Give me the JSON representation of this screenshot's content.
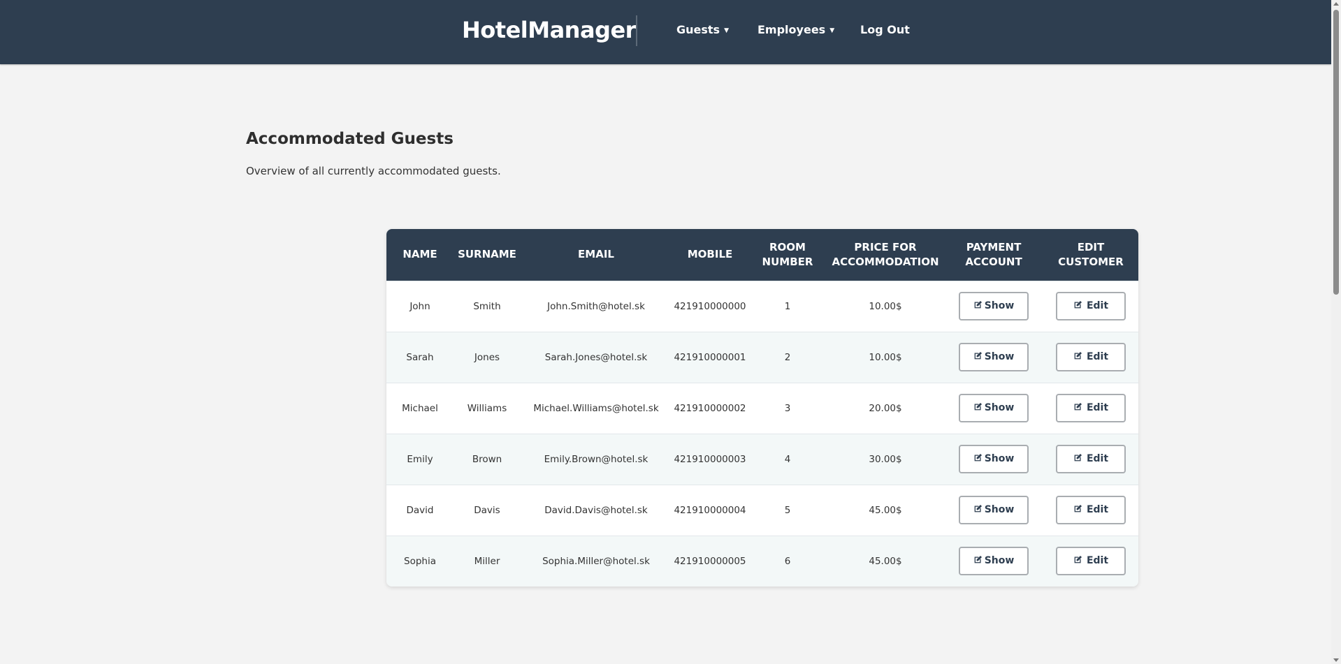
{
  "navbar": {
    "brand": "HotelManager",
    "items": [
      {
        "label": "Guests",
        "has_dropdown": true
      },
      {
        "label": "Employees",
        "has_dropdown": true
      },
      {
        "label": "Log Out",
        "has_dropdown": false
      }
    ],
    "caret_icon": "caret-down-icon",
    "background_color": "#2e3e50"
  },
  "page": {
    "title": "Accommodated Guests",
    "subtitle": "Overview of all currently accommodated guests."
  },
  "table": {
    "header_color": "#2e3e50",
    "columns": [
      {
        "line1": "NAME",
        "line2": ""
      },
      {
        "line1": "SURNAME",
        "line2": ""
      },
      {
        "line1": "EMAIL",
        "line2": ""
      },
      {
        "line1": "MOBILE",
        "line2": ""
      },
      {
        "line1": "ROOM",
        "line2": "NUMBER"
      },
      {
        "line1": "PRICE FOR",
        "line2": "ACCOMMODATION"
      },
      {
        "line1": "PAYMENT",
        "line2": "ACCOUNT"
      },
      {
        "line1": "EDIT",
        "line2": "CUSTOMER"
      }
    ],
    "rows": [
      {
        "name": "John",
        "surname": "Smith",
        "email": "John.Smith@hotel.sk",
        "mobile": "421910000000",
        "room": "1",
        "price": "10.00$"
      },
      {
        "name": "Sarah",
        "surname": "Jones",
        "email": "Sarah.Jones@hotel.sk",
        "mobile": "421910000001",
        "room": "2",
        "price": "10.00$"
      },
      {
        "name": "Michael",
        "surname": "Williams",
        "email": "Michael.Williams@hotel.sk",
        "mobile": "421910000002",
        "room": "3",
        "price": "20.00$"
      },
      {
        "name": "Emily",
        "surname": "Brown",
        "email": "Emily.Brown@hotel.sk",
        "mobile": "421910000003",
        "room": "4",
        "price": "30.00$"
      },
      {
        "name": "David",
        "surname": "Davis",
        "email": "David.Davis@hotel.sk",
        "mobile": "421910000004",
        "room": "5",
        "price": "45.00$"
      },
      {
        "name": "Sophia",
        "surname": "Miller",
        "email": "Sophia.Miller@hotel.sk",
        "mobile": "421910000005",
        "room": "6",
        "price": "45.00$"
      }
    ],
    "show_button_label": "Show",
    "edit_button_label": "Edit",
    "button_icon": "edit-square-icon"
  }
}
